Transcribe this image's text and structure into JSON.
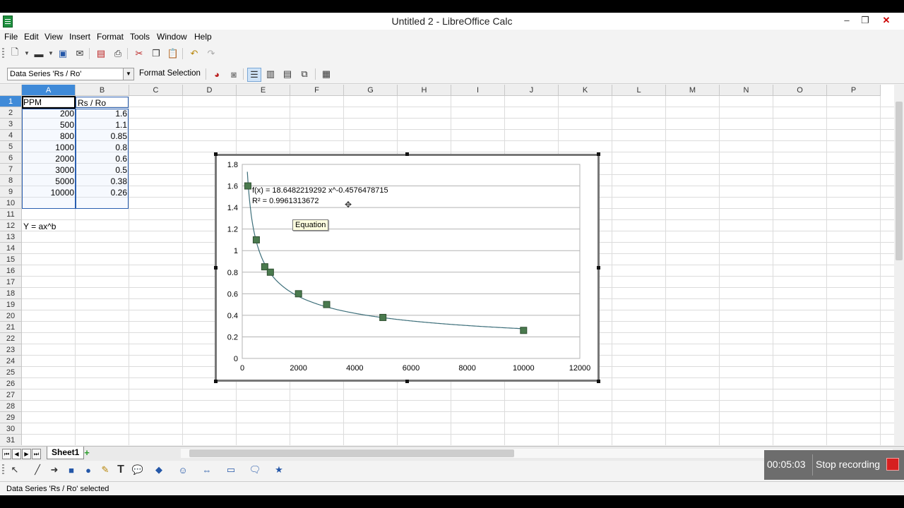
{
  "window": {
    "title": "Untitled 2 - LibreOffice Calc"
  },
  "menu": [
    "File",
    "Edit",
    "View",
    "Insert",
    "Format",
    "Tools",
    "Window",
    "Help"
  ],
  "chart_toolbar": {
    "element_select": "Data Series 'Rs / Ro'",
    "format_selection_label": "Format Selection"
  },
  "columns": [
    "A",
    "B",
    "C",
    "D",
    "E",
    "F",
    "G",
    "H",
    "I",
    "J",
    "K",
    "L",
    "M",
    "N",
    "O",
    "P"
  ],
  "rows": [
    "1",
    "2",
    "3",
    "4",
    "5",
    "6",
    "7",
    "8",
    "9",
    "10",
    "11",
    "12",
    "13",
    "14",
    "15",
    "16",
    "17",
    "18",
    "19",
    "20",
    "21",
    "22",
    "23",
    "24",
    "25",
    "26",
    "27",
    "28",
    "29",
    "30",
    "31"
  ],
  "sheet": {
    "header_a": "PPM",
    "header_b": "Rs / Ro",
    "ppm": [
      "200",
      "500",
      "800",
      "1000",
      "2000",
      "3000",
      "5000",
      "10000"
    ],
    "rsro": [
      "1.6",
      "1.1",
      "0.85",
      "0.8",
      "0.6",
      "0.5",
      "0.38",
      "0.26"
    ],
    "note": "Y = ax^b"
  },
  "chart_data": {
    "type": "scatter",
    "x": [
      200,
      500,
      800,
      1000,
      2000,
      3000,
      5000,
      10000
    ],
    "y": [
      1.6,
      1.1,
      0.85,
      0.8,
      0.6,
      0.5,
      0.38,
      0.26
    ],
    "xlim": [
      0,
      12000
    ],
    "ylim": [
      0,
      1.8
    ],
    "x_ticks": [
      "0",
      "2000",
      "4000",
      "6000",
      "8000",
      "10000",
      "12000"
    ],
    "y_ticks": [
      "0",
      "0.2",
      "0.4",
      "0.6",
      "0.8",
      "1",
      "1.2",
      "1.4",
      "1.6",
      "1.8"
    ],
    "trendline": {
      "type": "power",
      "a": 18.6482219292,
      "b": -0.4576478715
    },
    "equation": "f(x) = 18.6482219292 x^-0.4576478715",
    "r_squared": "R² = 0.9961313672",
    "tooltip": "Equation",
    "grid": true,
    "marker_color": "#4a7a4e",
    "line_color": "#3d6f7a"
  },
  "tabs": {
    "sheet1": "Sheet1"
  },
  "status": {
    "text": "Data Series 'Rs / Ro' selected"
  },
  "recorder": {
    "time": "00:05:03",
    "stop_label": "Stop recording"
  }
}
